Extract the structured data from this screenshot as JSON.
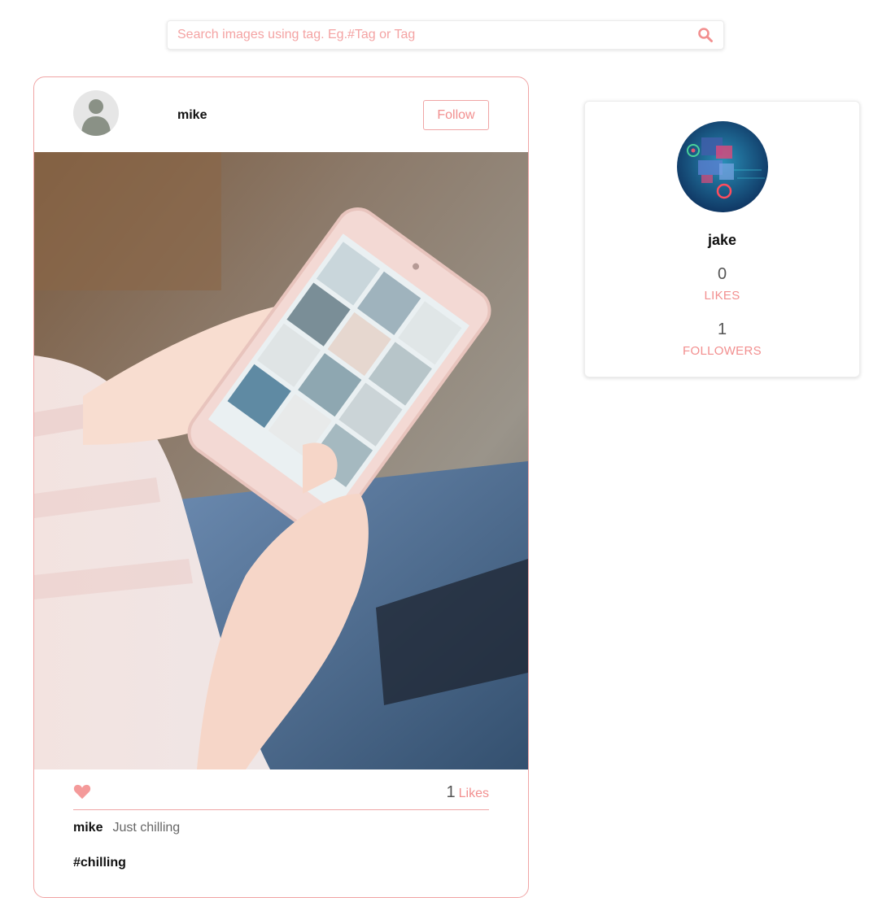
{
  "search": {
    "placeholder": "Search images using tag. Eg.#Tag or Tag",
    "icon": "search-icon"
  },
  "post": {
    "username": "mike",
    "follow_label": "Follow",
    "likes_count": "1",
    "likes_label": "Likes",
    "caption_user": "mike",
    "caption_text": "Just chilling",
    "hashtag": "#chilling"
  },
  "profile": {
    "name": "jake",
    "likes_count": "0",
    "likes_label": "LIKES",
    "followers_count": "1",
    "followers_label": "FOLLOWERS"
  },
  "colors": {
    "accent": "#f28f8f",
    "border": "#f0a5a5",
    "heart": "#f49a9a"
  }
}
